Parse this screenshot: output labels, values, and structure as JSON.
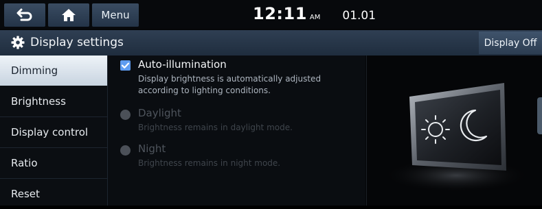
{
  "topbar": {
    "back_icon": "back-arrow-icon",
    "home_icon": "home-icon",
    "menu_label": "Menu",
    "time": "12:11",
    "ampm": "AM",
    "date": "01.01"
  },
  "header": {
    "icon": "gear-icon",
    "title": "Display settings",
    "display_off_label": "Display Off"
  },
  "sidebar": {
    "items": [
      {
        "label": "Dimming",
        "active": true
      },
      {
        "label": "Brightness",
        "active": false
      },
      {
        "label": "Display control",
        "active": false
      },
      {
        "label": "Ratio",
        "active": false
      },
      {
        "label": "Reset",
        "active": false
      }
    ]
  },
  "options": {
    "auto": {
      "title": "Auto-illumination",
      "desc_line1": "Display brightness is automatically adjusted",
      "desc_line2": "according to lighting conditions.",
      "checked": true
    },
    "daylight": {
      "title": "Daylight",
      "desc": "Brightness remains in daylight mode.",
      "enabled": false
    },
    "night": {
      "title": "Night",
      "desc": "Brightness remains in night mode.",
      "enabled": false
    }
  },
  "illustration": {
    "icons": [
      "sun-icon",
      "moon-icon"
    ]
  },
  "colors": {
    "accent": "#5e9cf0",
    "header": "#2f3f53",
    "active_item": "#eef3f8"
  }
}
